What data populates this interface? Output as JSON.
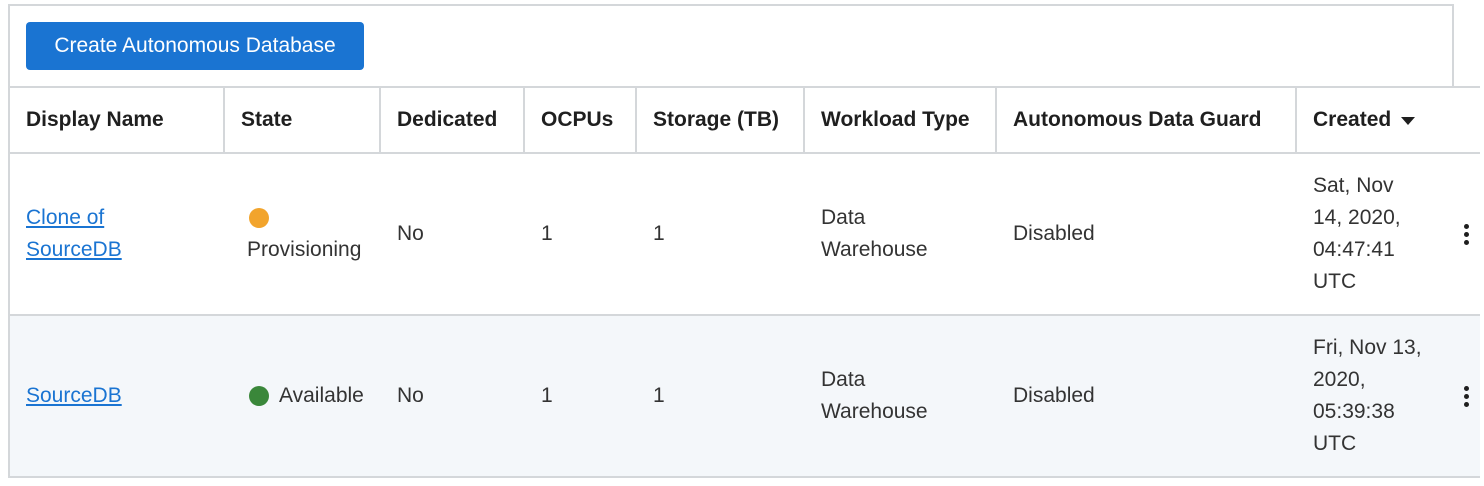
{
  "toolbar": {
    "create_label": "Create Autonomous Database"
  },
  "columns": {
    "display_name": "Display Name",
    "state": "State",
    "dedicated": "Dedicated",
    "ocpus": "OCPUs",
    "storage": "Storage (TB)",
    "workload": "Workload Type",
    "data_guard": "Autonomous Data Guard",
    "created": "Created"
  },
  "rows": [
    {
      "name_line1": "Clone of",
      "name_line2": "SourceDB",
      "state": "Provisioning",
      "state_color": "#f2a42c",
      "dedicated": "No",
      "ocpus": "1",
      "storage": "1",
      "workload_line1": "Data",
      "workload_line2": "Warehouse",
      "data_guard": "Disabled",
      "created_lines": [
        "Sat, Nov",
        "14, 2020,",
        "04:47:41",
        "UTC"
      ]
    },
    {
      "name_line1": "SourceDB",
      "state": "Available",
      "state_color": "#3a873a",
      "dedicated": "No",
      "ocpus": "1",
      "storage": "1",
      "workload_line1": "Data",
      "workload_line2": "Warehouse",
      "data_guard": "Disabled",
      "created_lines": [
        "Fri, Nov 13,",
        "2020,",
        "05:39:38",
        "UTC"
      ]
    }
  ],
  "colors": {
    "accent": "#1a74d2",
    "border": "#d4d7da",
    "alt_row": "#f4f7fa"
  }
}
